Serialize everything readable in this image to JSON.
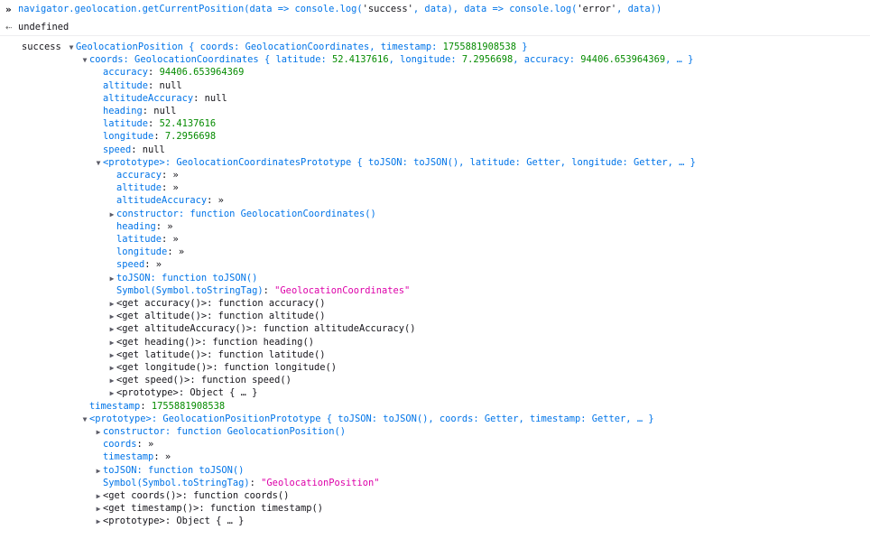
{
  "input": {
    "prompt": "»",
    "code": [
      {
        "t": "navigator.geolocation.getCurrentPosition(data ",
        "c": "blue"
      },
      {
        "t": "=>",
        "c": "blue"
      },
      {
        "t": " console.log(",
        "c": "blue"
      },
      {
        "t": "'success'",
        "c": "dark"
      },
      {
        "t": ", data), data ",
        "c": "blue"
      },
      {
        "t": "=>",
        "c": "blue"
      },
      {
        "t": " console.log(",
        "c": "blue"
      },
      {
        "t": "'error'",
        "c": "dark"
      },
      {
        "t": ", data))",
        "c": "blue"
      }
    ]
  },
  "result": {
    "arrow": "⇠",
    "value": "undefined"
  },
  "log": {
    "label": "success",
    "lines": [
      {
        "indent": 0,
        "tw": "open",
        "parts": [
          {
            "t": "GeolocationPosition { coords: GeolocationCoordinates, timestamp: ",
            "c": "blue"
          },
          {
            "t": "1755881908538",
            "c": "green"
          },
          {
            "t": " }",
            "c": "blue"
          }
        ]
      },
      {
        "indent": 1,
        "tw": "open",
        "parts": [
          {
            "t": "coords",
            "c": "blue"
          },
          {
            "t": ": GeolocationCoordinates { latitude: ",
            "c": "blue"
          },
          {
            "t": "52.4137616",
            "c": "green"
          },
          {
            "t": ", longitude: ",
            "c": "blue"
          },
          {
            "t": "7.2956698",
            "c": "green"
          },
          {
            "t": ", accuracy: ",
            "c": "blue"
          },
          {
            "t": "94406.653964369",
            "c": "green"
          },
          {
            "t": ", … }",
            "c": "blue"
          }
        ]
      },
      {
        "indent": 2,
        "tw": "none",
        "parts": [
          {
            "t": "accuracy",
            "c": "blue"
          },
          {
            "t": ": ",
            "c": "dark"
          },
          {
            "t": "94406.653964369",
            "c": "green"
          }
        ]
      },
      {
        "indent": 2,
        "tw": "none",
        "parts": [
          {
            "t": "altitude",
            "c": "blue"
          },
          {
            "t": ": null",
            "c": "dark"
          }
        ]
      },
      {
        "indent": 2,
        "tw": "none",
        "parts": [
          {
            "t": "altitudeAccuracy",
            "c": "blue"
          },
          {
            "t": ": null",
            "c": "dark"
          }
        ]
      },
      {
        "indent": 2,
        "tw": "none",
        "parts": [
          {
            "t": "heading",
            "c": "blue"
          },
          {
            "t": ": null",
            "c": "dark"
          }
        ]
      },
      {
        "indent": 2,
        "tw": "none",
        "parts": [
          {
            "t": "latitude",
            "c": "blue"
          },
          {
            "t": ": ",
            "c": "dark"
          },
          {
            "t": "52.4137616",
            "c": "green"
          }
        ]
      },
      {
        "indent": 2,
        "tw": "none",
        "parts": [
          {
            "t": "longitude",
            "c": "blue"
          },
          {
            "t": ": ",
            "c": "dark"
          },
          {
            "t": "7.2956698",
            "c": "green"
          }
        ]
      },
      {
        "indent": 2,
        "tw": "none",
        "parts": [
          {
            "t": "speed",
            "c": "blue"
          },
          {
            "t": ": null",
            "c": "dark"
          }
        ]
      },
      {
        "indent": 2,
        "tw": "open",
        "parts": [
          {
            "t": "<prototype>",
            "c": "blue"
          },
          {
            "t": ": GeolocationCoordinatesPrototype { toJSON: toJSON(), latitude: Getter, longitude: Getter, … }",
            "c": "blue"
          }
        ]
      },
      {
        "indent": 3,
        "tw": "none",
        "parts": [
          {
            "t": "accuracy",
            "c": "blue"
          },
          {
            "t": ": »",
            "c": "dark"
          }
        ]
      },
      {
        "indent": 3,
        "tw": "none",
        "parts": [
          {
            "t": "altitude",
            "c": "blue"
          },
          {
            "t": ": »",
            "c": "dark"
          }
        ]
      },
      {
        "indent": 3,
        "tw": "none",
        "parts": [
          {
            "t": "altitudeAccuracy",
            "c": "blue"
          },
          {
            "t": ": »",
            "c": "dark"
          }
        ]
      },
      {
        "indent": 3,
        "tw": "closed",
        "parts": [
          {
            "t": "constructor",
            "c": "blue"
          },
          {
            "t": ": function GeolocationCoordinates()",
            "c": "blue"
          }
        ]
      },
      {
        "indent": 3,
        "tw": "none",
        "parts": [
          {
            "t": "heading",
            "c": "blue"
          },
          {
            "t": ": »",
            "c": "dark"
          }
        ]
      },
      {
        "indent": 3,
        "tw": "none",
        "parts": [
          {
            "t": "latitude",
            "c": "blue"
          },
          {
            "t": ": »",
            "c": "dark"
          }
        ]
      },
      {
        "indent": 3,
        "tw": "none",
        "parts": [
          {
            "t": "longitude",
            "c": "blue"
          },
          {
            "t": ": »",
            "c": "dark"
          }
        ]
      },
      {
        "indent": 3,
        "tw": "none",
        "parts": [
          {
            "t": "speed",
            "c": "blue"
          },
          {
            "t": ": »",
            "c": "dark"
          }
        ]
      },
      {
        "indent": 3,
        "tw": "closed",
        "parts": [
          {
            "t": "toJSON",
            "c": "blue"
          },
          {
            "t": ": function toJSON()",
            "c": "blue"
          }
        ]
      },
      {
        "indent": 3,
        "tw": "none",
        "parts": [
          {
            "t": "Symbol(Symbol.toStringTag)",
            "c": "blue"
          },
          {
            "t": ": ",
            "c": "dark"
          },
          {
            "t": "\"GeolocationCoordinates\"",
            "c": "pink"
          }
        ]
      },
      {
        "indent": 3,
        "tw": "closed",
        "parts": [
          {
            "t": "<get accuracy()>: function accuracy()",
            "c": "dark"
          }
        ]
      },
      {
        "indent": 3,
        "tw": "closed",
        "parts": [
          {
            "t": "<get altitude()>: function altitude()",
            "c": "dark"
          }
        ]
      },
      {
        "indent": 3,
        "tw": "closed",
        "parts": [
          {
            "t": "<get altitudeAccuracy()>: function altitudeAccuracy()",
            "c": "dark"
          }
        ]
      },
      {
        "indent": 3,
        "tw": "closed",
        "parts": [
          {
            "t": "<get heading()>: function heading()",
            "c": "dark"
          }
        ]
      },
      {
        "indent": 3,
        "tw": "closed",
        "parts": [
          {
            "t": "<get latitude()>: function latitude()",
            "c": "dark"
          }
        ]
      },
      {
        "indent": 3,
        "tw": "closed",
        "parts": [
          {
            "t": "<get longitude()>: function longitude()",
            "c": "dark"
          }
        ]
      },
      {
        "indent": 3,
        "tw": "closed",
        "parts": [
          {
            "t": "<get speed()>: function speed()",
            "c": "dark"
          }
        ]
      },
      {
        "indent": 3,
        "tw": "closed",
        "parts": [
          {
            "t": "<prototype>: Object { … }",
            "c": "dark"
          }
        ]
      },
      {
        "indent": 1,
        "tw": "none",
        "parts": [
          {
            "t": "timestamp",
            "c": "blue"
          },
          {
            "t": ": ",
            "c": "dark"
          },
          {
            "t": "1755881908538",
            "c": "green"
          }
        ]
      },
      {
        "indent": 1,
        "tw": "open",
        "parts": [
          {
            "t": "<prototype>",
            "c": "blue"
          },
          {
            "t": ": GeolocationPositionPrototype { toJSON: toJSON(), coords: Getter, timestamp: Getter, … }",
            "c": "blue"
          }
        ]
      },
      {
        "indent": 2,
        "tw": "closed",
        "parts": [
          {
            "t": "constructor",
            "c": "blue"
          },
          {
            "t": ": function GeolocationPosition()",
            "c": "blue"
          }
        ]
      },
      {
        "indent": 2,
        "tw": "none",
        "parts": [
          {
            "t": "coords",
            "c": "blue"
          },
          {
            "t": ": »",
            "c": "dark"
          }
        ]
      },
      {
        "indent": 2,
        "tw": "none",
        "parts": [
          {
            "t": "timestamp",
            "c": "blue"
          },
          {
            "t": ": »",
            "c": "dark"
          }
        ]
      },
      {
        "indent": 2,
        "tw": "closed",
        "parts": [
          {
            "t": "toJSON",
            "c": "blue"
          },
          {
            "t": ": function toJSON()",
            "c": "blue"
          }
        ]
      },
      {
        "indent": 2,
        "tw": "none",
        "parts": [
          {
            "t": "Symbol(Symbol.toStringTag)",
            "c": "blue"
          },
          {
            "t": ": ",
            "c": "dark"
          },
          {
            "t": "\"GeolocationPosition\"",
            "c": "pink"
          }
        ]
      },
      {
        "indent": 2,
        "tw": "closed",
        "parts": [
          {
            "t": "<get coords()>: function coords()",
            "c": "dark"
          }
        ]
      },
      {
        "indent": 2,
        "tw": "closed",
        "parts": [
          {
            "t": "<get timestamp()>: function timestamp()",
            "c": "dark"
          }
        ]
      },
      {
        "indent": 2,
        "tw": "closed",
        "parts": [
          {
            "t": "<prototype>: Object { … }",
            "c": "dark"
          }
        ]
      }
    ]
  },
  "colors": {
    "blue": "#0074e8",
    "green": "#058b00",
    "pink": "#dd00a9",
    "dark": "#15141a"
  }
}
